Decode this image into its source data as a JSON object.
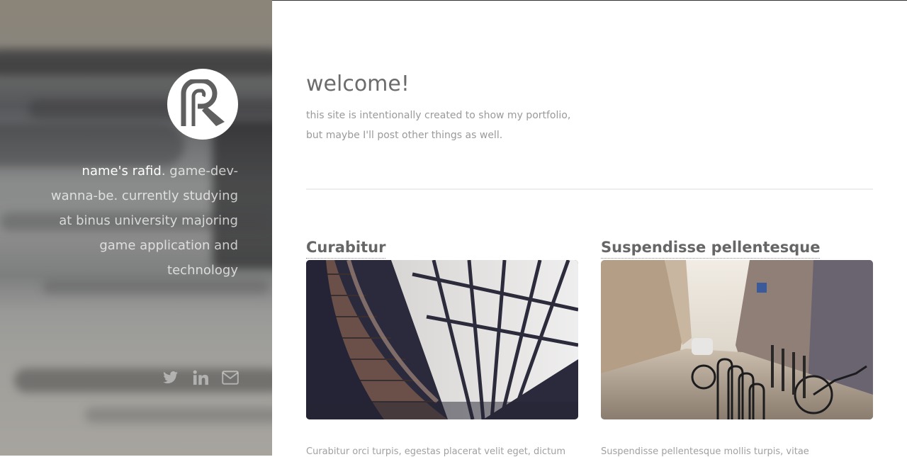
{
  "sidebar": {
    "avatar_icon": "rafid-logo-R",
    "bio_name": "name's rafid",
    "bio_text": ". game-dev-wanna-be. currently studying at binus university majoring game application and technology",
    "socials": [
      {
        "icon": "twitter-icon"
      },
      {
        "icon": "linkedin-icon"
      },
      {
        "icon": "envelope-icon"
      }
    ]
  },
  "main": {
    "welcome_title": "welcome!",
    "welcome_line1": "this site is intentionally created to show my portfolio,",
    "welcome_line2": "but maybe I'll post other things as well.",
    "posts": [
      {
        "title": "Curabitur",
        "image": "library-bookshelves-photo",
        "excerpt": "Curabitur orci turpis, egestas placerat velit eget, dictum"
      },
      {
        "title": "Suspendisse pellentesque",
        "image": "city-street-bicycles-photo",
        "excerpt": "Suspendisse pellentesque mollis turpis, vitae"
      }
    ]
  },
  "colors": {
    "heading": "#6b6b6b",
    "muted_text": "#9a9a9a",
    "sidebar_text": "#ffffff"
  }
}
